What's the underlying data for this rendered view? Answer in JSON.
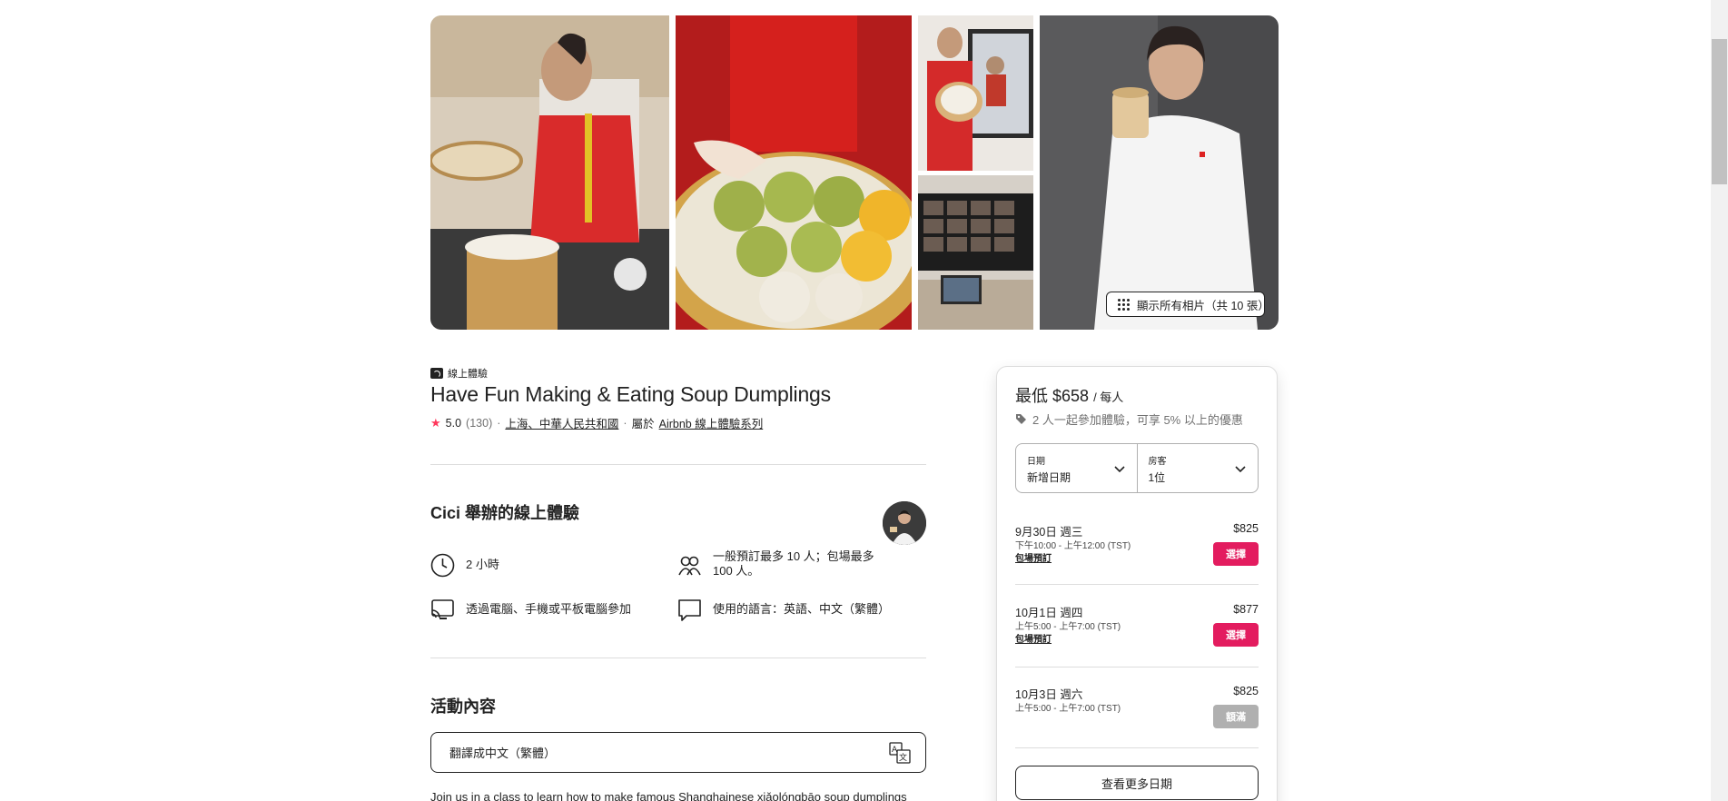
{
  "gallery": {
    "show_all_label": "顯示所有相片（共 10 張）"
  },
  "listing": {
    "category_tag": "線上體驗",
    "title": "Have Fun Making & Eating Soup Dumplings",
    "rating": "5.0",
    "review_count": "(130)",
    "location": "上海、中華人民共和國",
    "separator": "·",
    "series_prefix": "屬於",
    "series_link": "Airbnb 線上體驗系列"
  },
  "host": {
    "title": "Cici 舉辦的線上體驗"
  },
  "features": {
    "duration": "2 小時",
    "group_size": "一般預訂最多 10 人；包場最多 100 人。",
    "devices": "透過電腦、手機或平板電腦參加",
    "languages": "使用的語言：英語、中文（繁體）"
  },
  "activity": {
    "section_title": "活動內容",
    "translate_label": "翻譯成中文（繁體）",
    "description": "Join us in a class to learn how to make famous Shanghainese xiǎolóngbāo soup dumplings"
  },
  "booking": {
    "price_prefix": "最低",
    "price": "$658",
    "price_unit": "/ 每人",
    "discount_text": "2 人一起參加體驗，可享 5% 以上的優惠",
    "date_label": "日期",
    "date_value": "新增日期",
    "guests_label": "房客",
    "guests_value": "1位",
    "slots": [
      {
        "date": "9月30日 週三",
        "time": "下午10:00 - 上午12:00 (TST)",
        "private": "包場預訂",
        "price": "$825",
        "button": "選擇"
      },
      {
        "date": "10月1日 週四",
        "time": "上午5:00 - 上午7:00 (TST)",
        "private": "包場預訂",
        "price": "$877",
        "button": "選擇"
      },
      {
        "date": "10月3日 週六",
        "time": "上午5:00 - 上午7:00 (TST)",
        "private": "",
        "price": "$825",
        "button": "額滿"
      }
    ],
    "more_dates_label": "查看更多日期"
  },
  "colors": {
    "brand": "#e31c5f",
    "star": "#ff385c",
    "disabled": "#b0b0b0"
  }
}
